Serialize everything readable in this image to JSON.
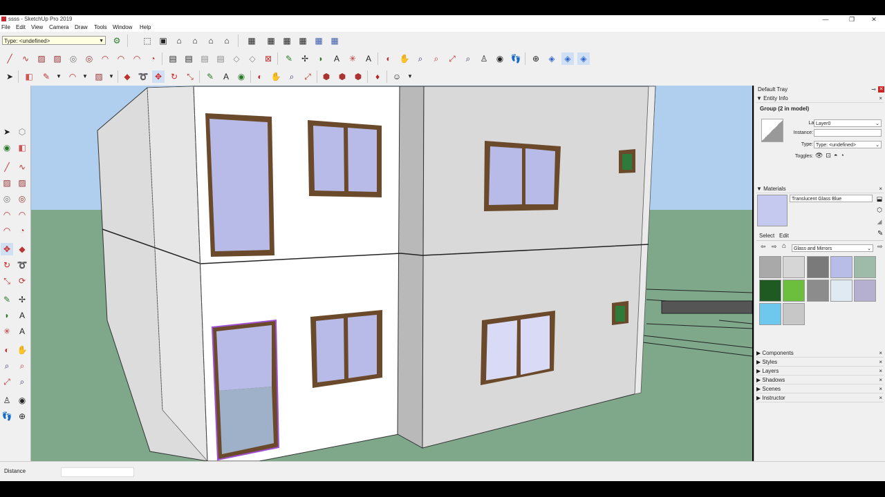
{
  "window": {
    "title": "ssss - SketchUp Pro 2019",
    "minimize": "—",
    "restore": "❐",
    "close": "✕"
  },
  "menu": [
    "File",
    "Edit",
    "View",
    "Camera",
    "Draw",
    "Tools",
    "Window",
    "Help"
  ],
  "toolbar": {
    "type_value": "Type: <undefined>"
  },
  "status": {
    "label": "Distance",
    "value": ""
  },
  "tray": {
    "title": "Default Tray",
    "entity_info": {
      "header": "Entity Info",
      "selection": "Group (2 in model)",
      "layer_label": "Layer:",
      "layer_value": "Layer0",
      "instance_label": "Instance:",
      "instance_value": "",
      "type_label": "Type:",
      "type_value": "Type: <undefined>",
      "toggles_label": "Toggles:"
    },
    "materials": {
      "header": "Materials",
      "name": "Translucent Glass Blue",
      "tab_select": "Select",
      "tab_edit": "Edit",
      "collection": "Glass and Mirrors",
      "swatch_colors": [
        "#a9a9a9",
        "#d6d6d6",
        "#7a7a7a",
        "#b8bde8",
        "#9dbba8",
        "#1f5a22",
        "#6cbf3c",
        "#8c8c8c",
        "#dfeaf3",
        "#b6b0d0",
        "#6ec8ee",
        "#c7c7c7"
      ],
      "accent_color": "#c5c8ef"
    },
    "sections": [
      "Components",
      "Styles",
      "Layers",
      "Shadows",
      "Scenes",
      "Instructor"
    ]
  },
  "colors": {
    "sky": "#b0cfee",
    "ground": "#7fa88a",
    "wall_front": "#ffffff",
    "wall_side": "#d8d8d8",
    "frame": "#6a4a2a",
    "glass": "#b8bbe8"
  }
}
